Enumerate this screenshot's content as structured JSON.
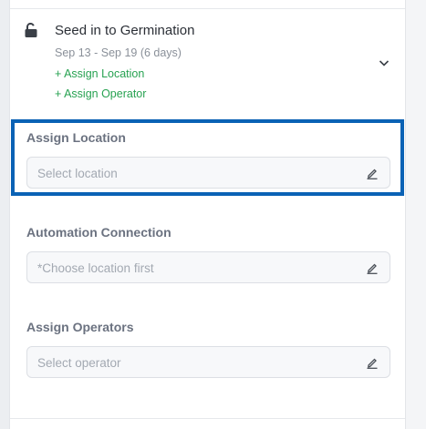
{
  "step": {
    "title": "Seed in to Germination",
    "dates": "Sep 13 - Sep 19 (6 days)",
    "assign_location_link": "+ Assign Location",
    "assign_operator_link": "+ Assign Operator",
    "status_icon": "unlock-icon",
    "expand_icon": "chevron-down-icon"
  },
  "fields": {
    "location": {
      "label": "Assign Location",
      "placeholder": "Select location",
      "highlighted": true
    },
    "automation": {
      "label": "Automation Connection",
      "placeholder": "*Choose location first"
    },
    "operators": {
      "label": "Assign Operators",
      "placeholder": "Select operator"
    }
  },
  "colors": {
    "link_green": "#27a251",
    "highlight_blue": "#0a62b5"
  }
}
